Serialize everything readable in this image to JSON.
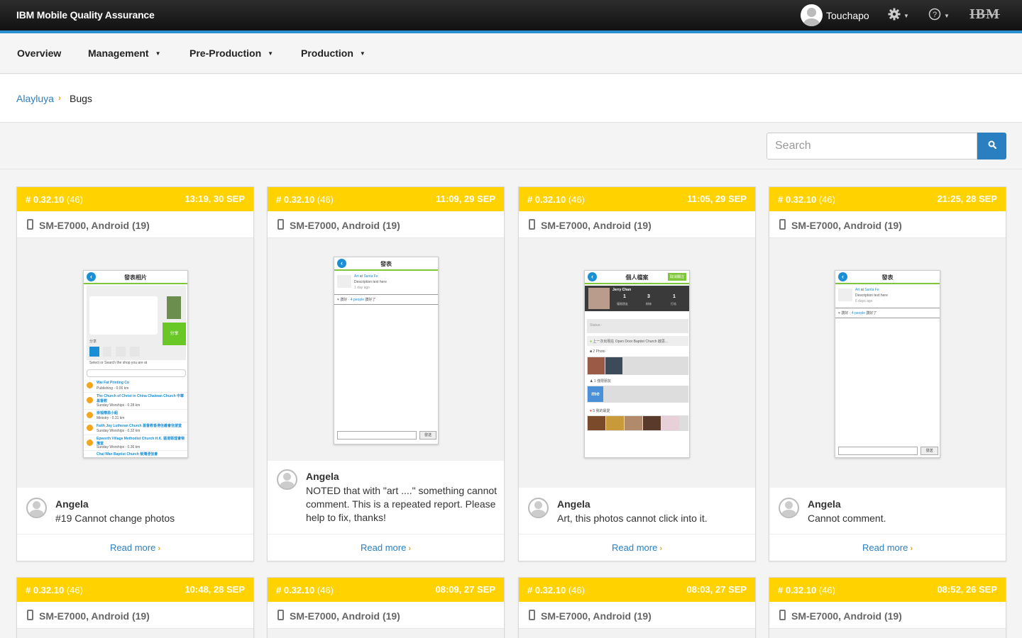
{
  "header": {
    "app_title": "IBM Mobile Quality Assurance",
    "username": "Touchapo",
    "settings_icon": "gear-icon",
    "help_icon": "help-circle-icon",
    "logo_text": "IBM"
  },
  "nav": {
    "items": [
      {
        "label": "Overview"
      },
      {
        "label": "Management"
      },
      {
        "label": "Pre-Production"
      },
      {
        "label": "Production"
      }
    ]
  },
  "breadcrumb": {
    "parent": "Alayluya",
    "current": "Bugs"
  },
  "search": {
    "placeholder": "Search",
    "button_icon": "search-icon"
  },
  "colors": {
    "accent": "#2a7fc1",
    "card_header": "#ffd200",
    "top_line": "#2a8fd1"
  },
  "cards": [
    {
      "build": "# 0.32.10",
      "count": "(46)",
      "time": "13:19, 30 SEP",
      "device": "SM-E7000, Android (19)",
      "author": "Angela",
      "comment": "#19 Cannot change photos",
      "read_more": "Read more",
      "screen": {
        "title": "發表相片",
        "share": "分享",
        "share_label": "分享",
        "search_hint": "Select or Search the shop you are at",
        "places": [
          {
            "name": "Wai Fat Printing Co",
            "meta": "Publishing - 0.06 km"
          },
          {
            "name": "The Church of Christ in China Chaiwan Church 中華基督教",
            "meta": "Sunday Worships - 0.28 km"
          },
          {
            "name": "崇福懷恩小組",
            "meta": "Ministry - 0.31 km"
          },
          {
            "name": "Faith Joy Lutheran Church 基督教香港信義會信望堂",
            "meta": "Sunday Worships - 0.32 km"
          },
          {
            "name": "Epworth Village Methodist Church H.K. 循道衛理會柴灣堂",
            "meta": "Sunday Worships - 0.36 km"
          },
          {
            "name": "Chai Wan Baptist Church 柴灣浸信會",
            "meta": ""
          }
        ]
      }
    },
    {
      "build": "# 0.32.10",
      "count": "(46)",
      "time": "11:09, 29 SEP",
      "device": "SM-E7000, Android (19)",
      "author": "Angela",
      "comment": "NOTED that with \"art ....\" something cannot comment. This is a repeated report. Please help to fix, thanks!",
      "read_more": "Read more",
      "screen": {
        "title": "發表",
        "post_art": "Art",
        "post_at": "at",
        "post_place": "Santa Fe",
        "post_desc": "Description text here",
        "post_time": "1 day ago",
        "likes_pre": "讚好 ·",
        "likes_people": "4 people",
        "likes_post": "讚好了",
        "send": "發送"
      }
    },
    {
      "build": "# 0.32.10",
      "count": "(46)",
      "time": "11:05, 29 SEP",
      "device": "SM-E7000, Android (19)",
      "author": "Angela",
      "comment": "Art, this photos cannot click into it.",
      "read_more": "Read more",
      "screen": {
        "title": "個人檔案",
        "tag": "取消關注",
        "name": "Jerry Chan",
        "stats": [
          {
            "n": "1",
            "l": "僅限朋友"
          },
          {
            "n": "3",
            "l": "粉絲"
          },
          {
            "n": "1",
            "l": "打咭"
          }
        ],
        "status": "Status:-",
        "checkin": "上一次出現在 Open Door Baptist Church 啟思...",
        "photos": "2 Photo",
        "friends": "1 僅限朋友",
        "favs": "5 我的最愛",
        "me": "me"
      }
    },
    {
      "build": "# 0.32.10",
      "count": "(46)",
      "time": "21:25, 28 SEP",
      "device": "SM-E7000, Android (19)",
      "author": "Angela",
      "comment": "Cannot comment.",
      "read_more": "Read more",
      "screen": {
        "title": "發表",
        "post_art": "Art",
        "post_at": "at",
        "post_place": "Santa Fe",
        "post_desc": "Description text here",
        "post_time": "6 days ago",
        "likes_pre": "讚好 ·",
        "likes_people": "4 people",
        "likes_post": "讚好了",
        "send": "發送"
      }
    },
    {
      "build": "# 0.32.10",
      "count": "(46)",
      "time": "10:48, 28 SEP",
      "device": "SM-E7000, Android (19)"
    },
    {
      "build": "# 0.32.10",
      "count": "(46)",
      "time": "08:09, 27 SEP",
      "device": "SM-E7000, Android (19)"
    },
    {
      "build": "# 0.32.10",
      "count": "(46)",
      "time": "08:03, 27 SEP",
      "device": "SM-E7000, Android (19)"
    },
    {
      "build": "# 0.32.10",
      "count": "(46)",
      "time": "08:52, 26 SEP",
      "device": "SM-E7000, Android (19)"
    }
  ]
}
